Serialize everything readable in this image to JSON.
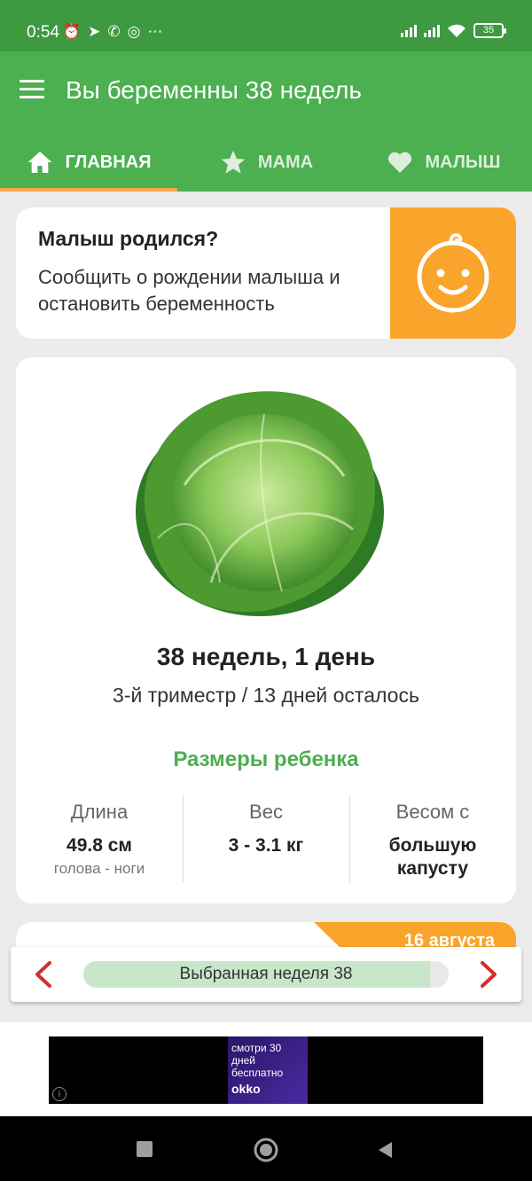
{
  "status_bar": {
    "time": "0:54",
    "icons": [
      "alarm-icon",
      "telegram-icon",
      "whatsapp-icon",
      "instagram-icon",
      "more-icon"
    ],
    "battery": "35"
  },
  "app_bar": {
    "title": "Вы беременны 38 недель",
    "tabs": [
      {
        "label": "ГЛАВНАЯ",
        "icon": "home-icon",
        "active": true
      },
      {
        "label": "МАМА",
        "icon": "star-icon",
        "active": false
      },
      {
        "label": "МАЛЫШ",
        "icon": "heart-icon",
        "active": false
      }
    ],
    "accent_color": "#4caf50",
    "tab_indicator_color": "#f7a64a"
  },
  "birth_card": {
    "title": "Малыш родился?",
    "description": "Сообщить о рождении малыша и остановить беременность",
    "icon": "baby-face-icon",
    "color": "#f9a42a"
  },
  "week_card": {
    "image": "cabbage",
    "title": "38 недель, 1 день",
    "subtitle": "3-й триместр / 13 дней осталось",
    "sizes_title": "Размеры ребенка",
    "stats": [
      {
        "label": "Длина",
        "value": "49.8 см",
        "note": "голова - ноги"
      },
      {
        "label": "Вес",
        "value": "3 - 3.1 кг",
        "note": ""
      },
      {
        "label": "Весом с",
        "value": "большую капусту",
        "note": ""
      }
    ]
  },
  "next_card": {
    "date": "16 августа"
  },
  "week_selector": {
    "label": "Выбранная неделя 38",
    "progress": 0.95
  },
  "ad": {
    "promo_text": "смотри 30 дней бесплатно",
    "brand": "okko"
  }
}
